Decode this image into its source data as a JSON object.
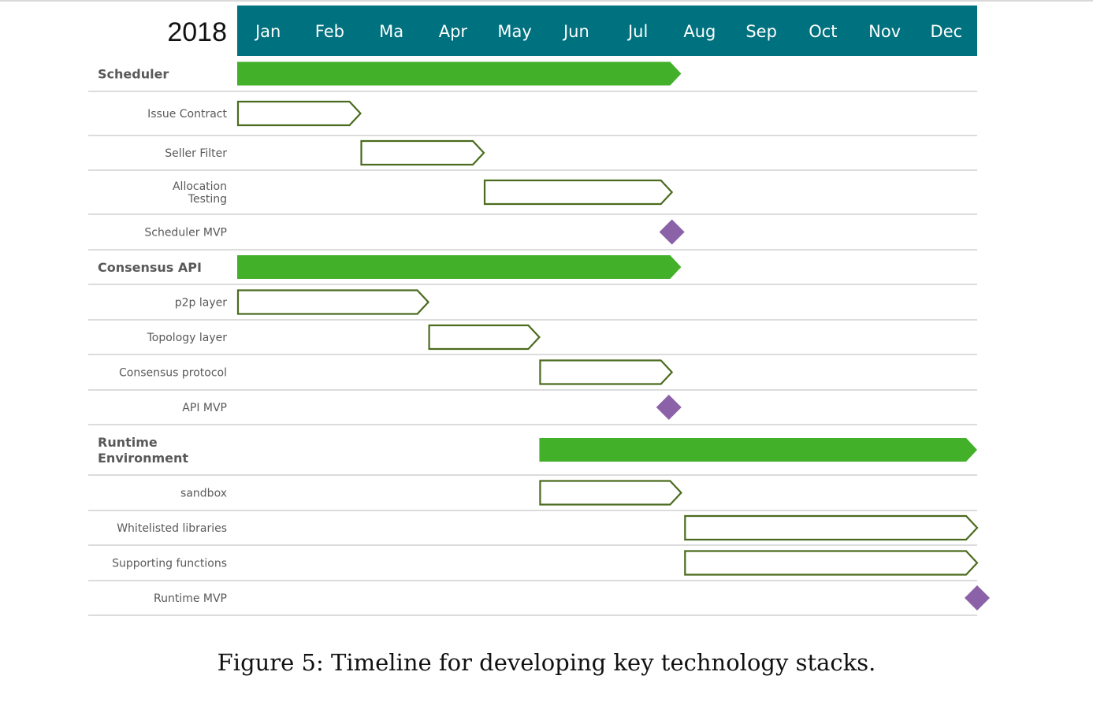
{
  "chart_data": {
    "type": "gantt",
    "year": "2018",
    "months": [
      "Jan",
      "Feb",
      "Ma",
      "Apr",
      "May",
      "Jun",
      "Jul",
      "Aug",
      "Sep",
      "Oct",
      "Nov",
      "Dec"
    ],
    "rows": [
      {
        "label": "Scheduler",
        "kind": "group",
        "start": 0.0,
        "end": 7.2
      },
      {
        "label": "Issue Contract",
        "kind": "task",
        "start": 0.0,
        "end": 2.0
      },
      {
        "label": "Seller Filter",
        "kind": "task",
        "start": 2.0,
        "end": 4.0
      },
      {
        "label": "Allocation\nTesting",
        "kind": "task",
        "start": 4.0,
        "end": 7.05
      },
      {
        "label": "Scheduler MVP",
        "kind": "milestone",
        "at": 7.05
      },
      {
        "label": "Consensus API",
        "kind": "group",
        "start": 0.0,
        "end": 7.2
      },
      {
        "label": "p2p layer",
        "kind": "task",
        "start": 0.0,
        "end": 3.1
      },
      {
        "label": "Topology layer",
        "kind": "task",
        "start": 3.1,
        "end": 4.9
      },
      {
        "label": "Consensus protocol",
        "kind": "task",
        "start": 4.9,
        "end": 7.05
      },
      {
        "label": "API MVP",
        "kind": "milestone",
        "at": 7.0
      },
      {
        "label": "Runtime\nEnvironment",
        "kind": "group",
        "start": 4.9,
        "end": 12.0
      },
      {
        "label": "sandbox",
        "kind": "task",
        "start": 4.9,
        "end": 7.2
      },
      {
        "label": "Whitelisted libraries",
        "kind": "task",
        "start": 7.25,
        "end": 12.0
      },
      {
        "label": "Supporting functions",
        "kind": "task",
        "start": 7.25,
        "end": 12.0
      },
      {
        "label": "Runtime MVP",
        "kind": "milestone",
        "at": 12.0
      }
    ],
    "colors": {
      "header": "#00717e",
      "header_text": "#ffffff",
      "group_bar": "#43b02a",
      "task_outline": "#4b6b1e",
      "milestone": "#8b62a8",
      "row_line": "#d0d0d0",
      "label_text": "#595959"
    }
  },
  "caption": "Figure 5: Timeline for developing key technology stacks."
}
